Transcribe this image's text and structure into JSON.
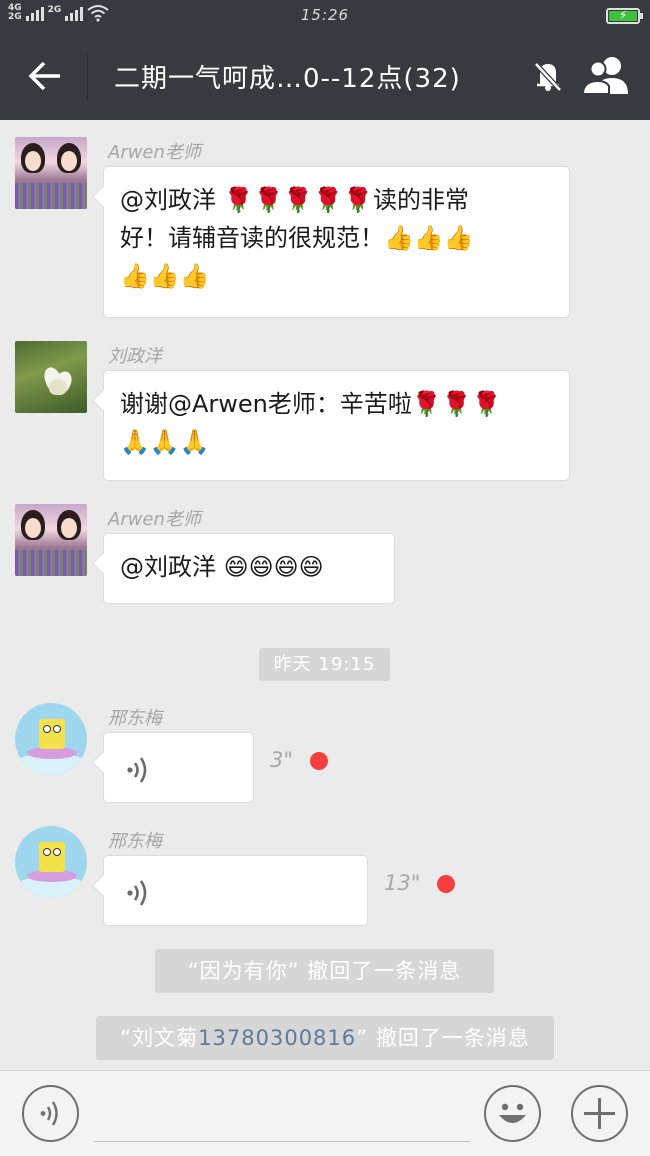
{
  "status_bar": {
    "network_top": "4G",
    "network_bottom": "2G",
    "network_2g_label": "2G",
    "time": "15:26",
    "battery_charging": true
  },
  "header": {
    "title": "二期一气呵成…0--12点(32)",
    "back_icon": "arrow-left-icon",
    "mute_icon": "bell-off-icon",
    "members_icon": "group-icon"
  },
  "messages": [
    {
      "sender": "Arwen老师",
      "text_line1": "@刘政洋 🌹🌹🌹🌹🌹读的非常",
      "text_line2": "好！请辅音读的很规范！👍👍👍",
      "text_line3": "👍👍👍"
    },
    {
      "sender": "刘政洋",
      "text_line1": "谢谢@Arwen老师：辛苦啦🌹🌹🌹",
      "text_line2": "🙏🙏🙏"
    },
    {
      "sender": "Arwen老师",
      "text_line1": "@刘政洋 😄😄😄😄"
    }
  ],
  "timestamp": "昨天 19:15",
  "voice_messages": [
    {
      "sender": "邢东梅",
      "duration": "3\"",
      "unread": true
    },
    {
      "sender": "邢东梅",
      "duration": "13\"",
      "unread": true
    }
  ],
  "system_notices": {
    "recall1": "“因为有你” 撤回了一条消息",
    "recall2_prefix": "“刘文菊",
    "recall2_phone": "13780300816",
    "recall2_suffix": "” 撤回了一条消息"
  },
  "input_bar": {
    "voice_icon": "voice-mode-icon",
    "emoji_icon": "smiley-icon",
    "plus_icon": "plus-icon"
  },
  "colors": {
    "header_bg": "#393a3f",
    "chat_bg": "#ebebeb",
    "unread_dot": "#f43f3f",
    "battery": "#3ec13e"
  }
}
